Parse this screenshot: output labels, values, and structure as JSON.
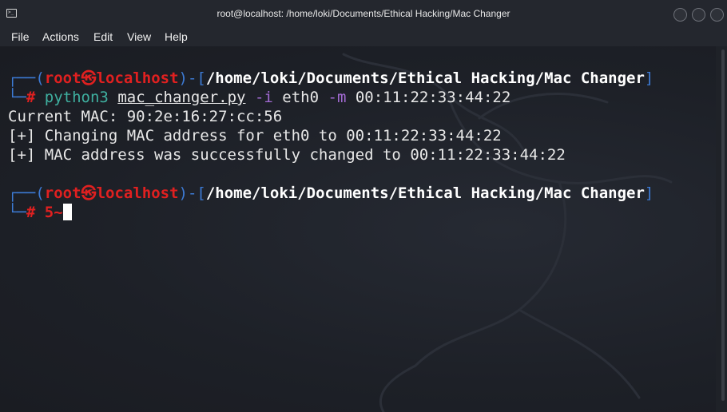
{
  "window": {
    "title": "root@localhost: /home/loki/Documents/Ethical Hacking/Mac Changer",
    "icon": "terminal-icon"
  },
  "menu": {
    "file": "File",
    "actions": "Actions",
    "edit": "Edit",
    "view": "View",
    "help": "Help"
  },
  "prompt1": {
    "corner": "┌──",
    "open": "(",
    "user": "root",
    "at": "㉿",
    "host": "localhost",
    "close": ")-[",
    "path": "/home/loki/Documents/Ethical Hacking/Mac Changer",
    "bracket_end": "]",
    "corner2": "└─",
    "hash": "#",
    "cmd": "python3",
    "script": "mac_changer.py",
    "flag_i": "-i",
    "iface": "eth0",
    "flag_m": "-m",
    "mac": "00:11:22:33:44:22"
  },
  "output": {
    "line1": "Current MAC: 90:2e:16:27:cc:56",
    "line2": "[+] Changing MAC address for eth0 to 00:11:22:33:44:22",
    "line3": "[+] MAC address was successfully changed to 00:11:22:33:44:22"
  },
  "prompt2": {
    "corner": "┌──",
    "open": "(",
    "user": "root",
    "at": "㉿",
    "host": "localhost",
    "close": ")-[",
    "path": "/home/loki/Documents/Ethical Hacking/Mac Changer",
    "bracket_end": "]",
    "corner2": "└─",
    "hash": "#",
    "input": "5~"
  },
  "colors": {
    "prompt_frame": "#3d7bd6",
    "prompt_user": "#e02020",
    "command": "#3fb0a0",
    "flag": "#a36bd4",
    "background": "#1c1f26"
  }
}
